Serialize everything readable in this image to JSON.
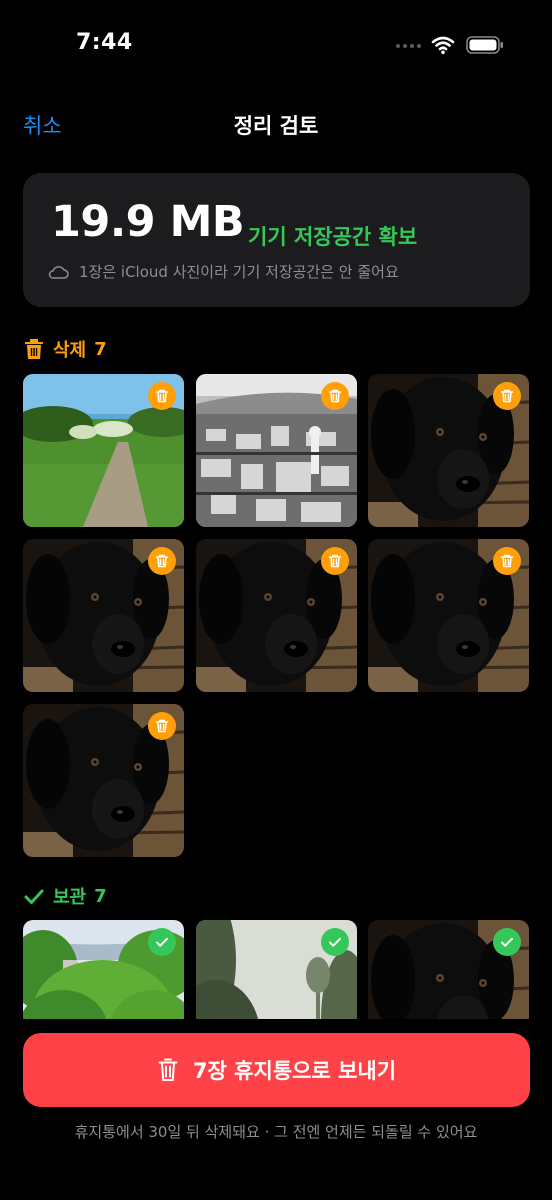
{
  "status_bar": {
    "time": "7:44"
  },
  "nav": {
    "cancel_label": "취소",
    "title": "정리 검토"
  },
  "summary": {
    "size": "19.9 MB",
    "freed_label": "기기 저장공간 확보",
    "note": "1장은 iCloud 사진이라 기기 저장공간은 안 줄어요"
  },
  "delete_section": {
    "label": "삭제",
    "count": "7",
    "photos": [
      "path",
      "city",
      "dog",
      "dog",
      "dog",
      "dog",
      "dog"
    ]
  },
  "keep_section": {
    "label": "보관",
    "count": "7",
    "photos": [
      "forest",
      "trees",
      "dog"
    ]
  },
  "primary_button": {
    "label": "7장 휴지통으로 보내기"
  },
  "footer_note": "휴지통에서 30일 뒤 삭제돼요 · 그 전엔 언제든 되돌릴 수 있어요",
  "colors": {
    "accent_blue": "#1d8cf8",
    "delete_orange": "#ff9f0a",
    "keep_green": "#35c759",
    "destructive_red": "#fe4248",
    "card_bg": "#1c1c1e"
  },
  "icons": {
    "trash": "trash-icon",
    "check": "checkmark-icon",
    "cloud": "cloud-icon",
    "wifi": "wifi-icon",
    "battery": "battery-icon"
  }
}
